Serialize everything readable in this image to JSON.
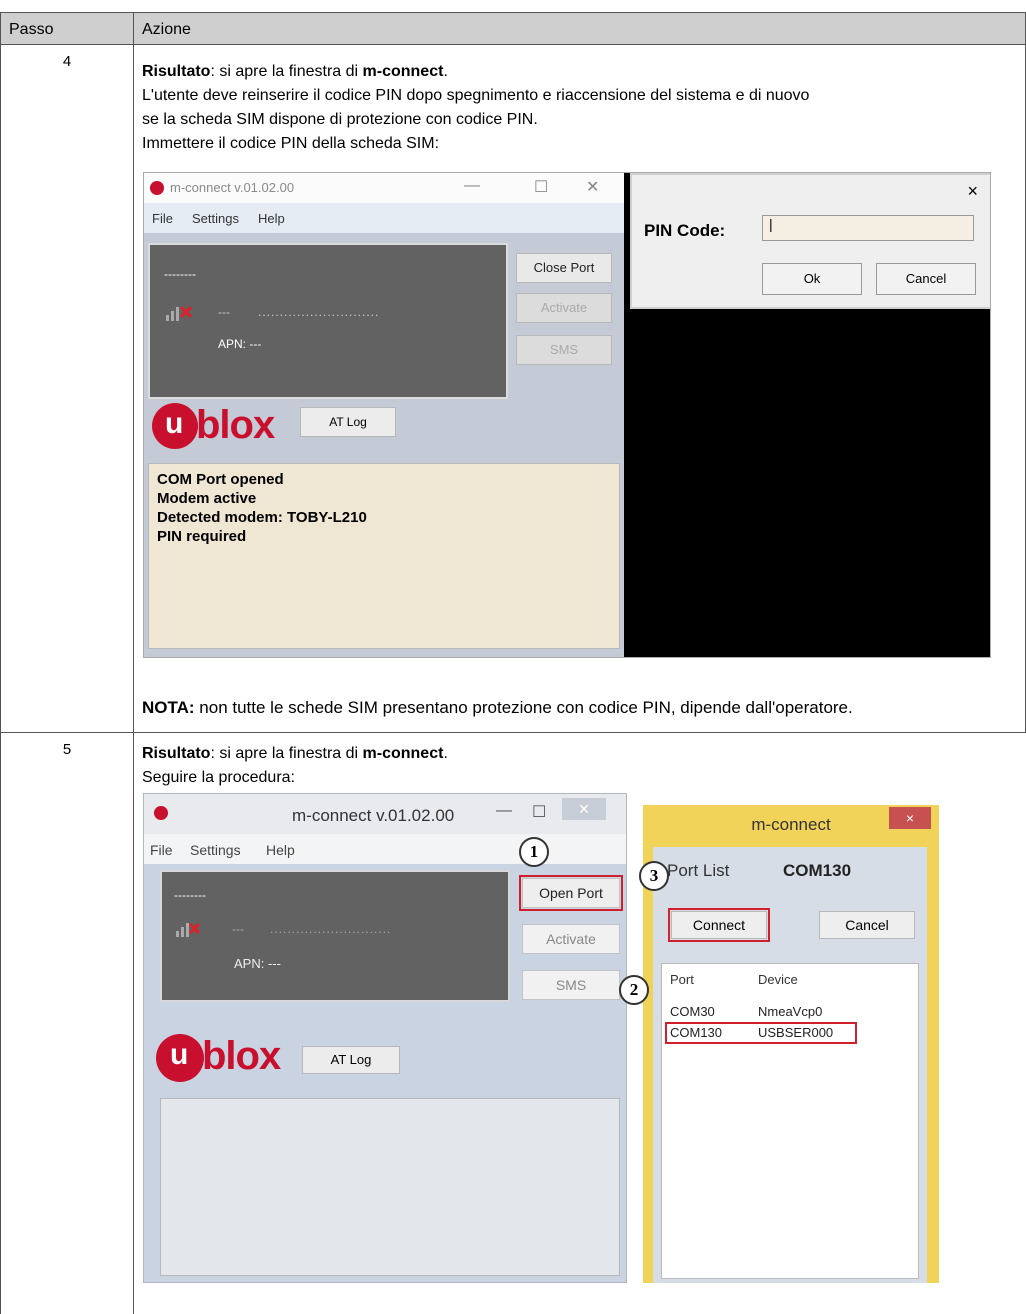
{
  "table": {
    "header_step": "Passo",
    "header_action": "Azione"
  },
  "rows": [
    {
      "step": "4",
      "result_label": "Risultato",
      "result_text_1": ": si apre la finestra di ",
      "result_app": "m-connect",
      "result_end": ".",
      "line2": "L'utente deve reinserire il codice PIN dopo spegnimento e riaccensione del sistema e di nuovo",
      "line3": "se la scheda SIM dispone di protezione con codice PIN.",
      "line4": "Immettere il codice PIN della scheda SIM:",
      "note_label": "NOTA:",
      "note_text": " non tutte le schede SIM presentano protezione con codice PIN, dipende dall'operatore."
    },
    {
      "step": "5",
      "result_label": "Risultato",
      "result_text_1": ": si apre la finestra di ",
      "result_app": "m-connect",
      "result_end": ".",
      "line2": "Seguire la procedura:"
    }
  ],
  "screen1": {
    "window_title": "m-connect v.01.02.00",
    "menu": [
      "File",
      "Settings",
      "Help"
    ],
    "status_dots": "--------",
    "status_dash": "---",
    "status_dotline": "............................",
    "apn": "APN: ---",
    "buttons": [
      "Close Port",
      "Activate",
      "SMS"
    ],
    "brand": "blox",
    "brand_u": "u",
    "at_log": "AT Log",
    "log_lines": [
      "COM Port opened",
      "Modem active",
      "Detected modem: TOBY-L210",
      "PIN required"
    ],
    "pin_dialog": {
      "close": "×",
      "label": "PIN Code:",
      "value": "|",
      "ok": "Ok",
      "cancel": "Cancel"
    }
  },
  "screen2": {
    "window_title": "m-connect v.01.02.00",
    "menu": [
      "File",
      "Settings",
      "Help"
    ],
    "status_dots": "--------",
    "status_dash": "---",
    "status_dotline": "............................",
    "apn": "APN: ---",
    "buttons": [
      "Open Port",
      "Activate",
      "SMS"
    ],
    "brand": "blox",
    "brand_u": "u",
    "at_log": "AT Log",
    "port_dialog": {
      "title": "m-connect",
      "close": "×",
      "port_list_label": "Port List",
      "port_list_value": "COM130",
      "connect": "Connect",
      "cancel": "Cancel",
      "col_port": "Port",
      "col_device": "Device",
      "rows": [
        {
          "port": "COM30",
          "device": "NmeaVcp0"
        },
        {
          "port": "COM130",
          "device": "USBSER000"
        }
      ]
    },
    "callouts": [
      "1",
      "2",
      "3"
    ]
  },
  "colors": {
    "brand_red": "#c8102e",
    "highlight_red": "#d0202c",
    "header_gray": "#cfcfcf"
  }
}
